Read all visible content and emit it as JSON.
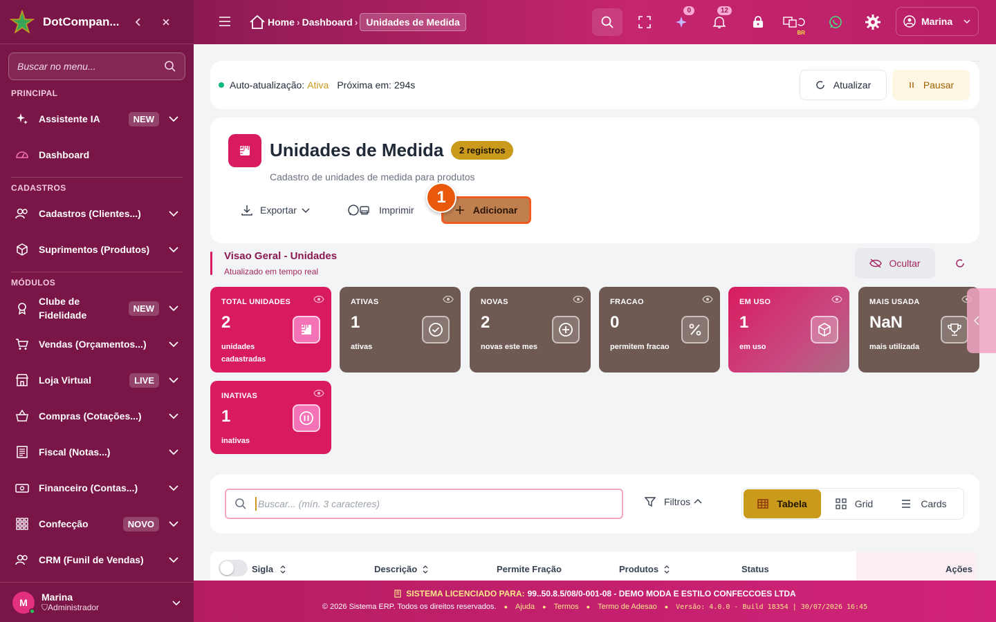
{
  "brand": {
    "name": "DotCompan..."
  },
  "sidebar": {
    "search_placeholder": "Buscar no menu...",
    "sections": {
      "principal": "PRINCIPAL",
      "cadastros": "CADASTROS",
      "modulos": "MÓDULOS"
    },
    "items": [
      {
        "label": "Assistente IA",
        "badge": "NEW"
      },
      {
        "label": "Dashboard"
      },
      {
        "label": "Cadastros (Clientes...)"
      },
      {
        "label": "Suprimentos (Produtos)"
      },
      {
        "label": "Clube de Fidelidade",
        "badge": "NEW"
      },
      {
        "label": "Vendas (Orçamentos...)"
      },
      {
        "label": "Loja Virtual",
        "badge": "LIVE"
      },
      {
        "label": "Compras (Cotações...)"
      },
      {
        "label": "Fiscal (Notas...)"
      },
      {
        "label": "Financeiro (Contas...)"
      },
      {
        "label": "Confecção",
        "badge": "NOVO"
      },
      {
        "label": "CRM (Funil de Vendas)"
      }
    ],
    "user": {
      "initial": "M",
      "name": "Marina",
      "role": "Administrador"
    }
  },
  "topbar": {
    "breadcrumb": {
      "home": "Home",
      "dashboard": "Dashboard",
      "current": "Unidades de Medida"
    },
    "ai_count": "0",
    "notif_count": "12",
    "lang": "BR",
    "user_name": "Marina"
  },
  "autorefresh": {
    "label": "Auto-atualização:",
    "status": "Ativa",
    "next_label": "Próxima em:",
    "next_value": "294s",
    "refresh_btn": "Atualizar",
    "pause_btn": "Pausar"
  },
  "page": {
    "title": "Unidades de Medida",
    "count_badge": "2 registros",
    "subtitle": "Cadastro de unidades de medida para produtos",
    "export_btn": "Exportar",
    "print_btn": "Imprimir",
    "add_btn": "Adicionar",
    "step_number": "1"
  },
  "overview": {
    "title": "Visao Geral - Unidades",
    "subtitle": "Atualizado em tempo real",
    "hide_btn": "Ocultar"
  },
  "stats": [
    {
      "label": "TOTAL UNIDADES",
      "value": "2",
      "desc": "unidades cadastradas"
    },
    {
      "label": "ATIVAS",
      "value": "1",
      "desc": "ativas"
    },
    {
      "label": "NOVAS",
      "value": "2",
      "desc": "novas este mes"
    },
    {
      "label": "FRACAO",
      "value": "0",
      "desc": "permitem fracao"
    },
    {
      "label": "EM USO",
      "value": "1",
      "desc": "em uso"
    },
    {
      "label": "MAIS USADA",
      "value": "NaN",
      "desc": "mais utilizada"
    },
    {
      "label": "INATIVAS",
      "value": "1",
      "desc": "inativas"
    }
  ],
  "search": {
    "placeholder": "Buscar... (mín. 3 caracteres)",
    "filters_btn": "Filtros",
    "views": {
      "table": "Tabela",
      "grid": "Grid",
      "cards": "Cards"
    }
  },
  "table": {
    "columns": [
      "Sigla",
      "Descrição",
      "Permite Fração",
      "Produtos",
      "Status",
      "Ações"
    ]
  },
  "footer": {
    "license_label": "SISTEMA LICENCIADO PARA:",
    "license_value": "99..50.8.5/08/0-001-08 - DEMO MODA E ESTILO CONFECCOES LTDA",
    "copyright": "© 2026 Sistema ERP. Todos os direitos reservados.",
    "links": [
      "Ajuda",
      "Termos",
      "Termo de Adesao"
    ],
    "version": "Versão: 4.0.0 - Build 18354 | 30/07/2026 16:45"
  },
  "colors": {
    "primary": "#7a1547",
    "accent": "#d81b60",
    "gold": "#c99a1c",
    "add_button": "#c07f4f"
  }
}
